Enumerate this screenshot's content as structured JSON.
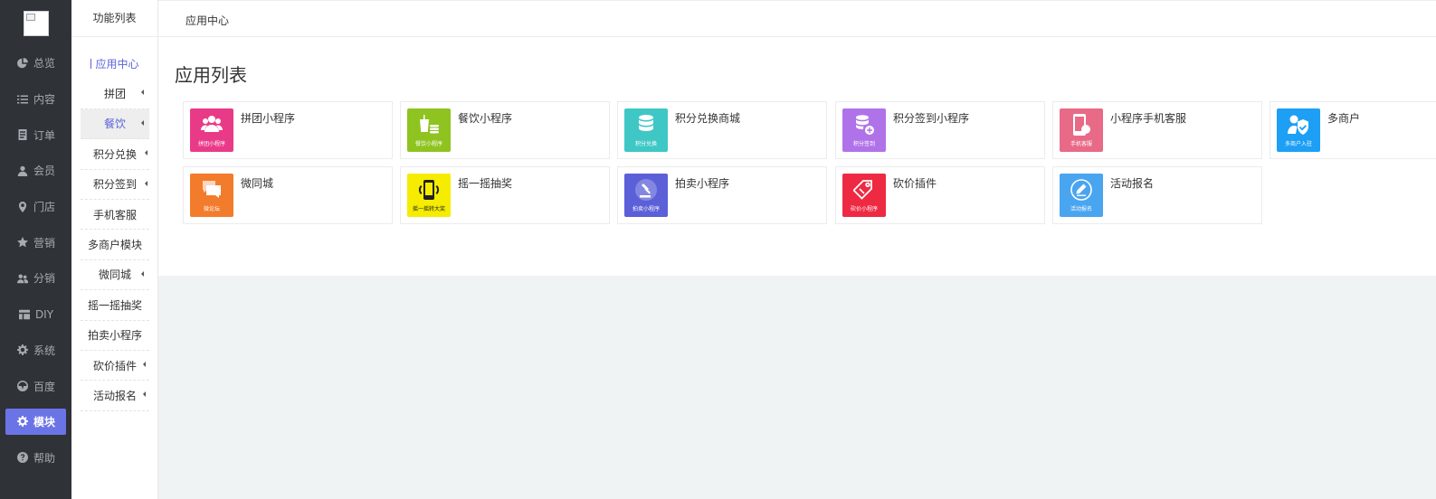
{
  "sidebar": {
    "items": [
      {
        "label": "总览",
        "icon": "pie-chart-icon"
      },
      {
        "label": "内容",
        "icon": "list-icon"
      },
      {
        "label": "订单",
        "icon": "document-icon"
      },
      {
        "label": "会员",
        "icon": "user-icon"
      },
      {
        "label": "门店",
        "icon": "location-pin-icon"
      },
      {
        "label": "营销",
        "icon": "star-icon"
      },
      {
        "label": "分销",
        "icon": "users-icon"
      },
      {
        "label": "DIY",
        "icon": "layout-icon"
      },
      {
        "label": "系统",
        "icon": "gear-icon"
      },
      {
        "label": "百度",
        "icon": "compass-icon"
      },
      {
        "label": "模块",
        "icon": "gear-icon",
        "active": true
      },
      {
        "label": "帮助",
        "icon": "question-icon"
      }
    ]
  },
  "subbar": {
    "title": "功能列表",
    "items": [
      {
        "label": "应用中心"
      },
      {
        "label": "拼团"
      },
      {
        "label": "餐饮"
      },
      {
        "label": "积分兑换"
      },
      {
        "label": "积分签到"
      },
      {
        "label": "手机客服"
      },
      {
        "label": "多商户模块"
      },
      {
        "label": "微同城"
      },
      {
        "label": "摇一摇抽奖"
      },
      {
        "label": "拍卖小程序"
      },
      {
        "label": "砍价插件"
      },
      {
        "label": "活动报名"
      }
    ]
  },
  "topbar": {
    "crumb": "应用中心"
  },
  "main": {
    "title": "应用列表",
    "apps": [
      {
        "name": "拼团小程序",
        "caption": "拼团小程序",
        "color": "#e93a88",
        "icon": "group-icon"
      },
      {
        "name": "餐饮小程序",
        "caption": "餐饮小程序",
        "color": "#8fc31f",
        "icon": "drink-icon"
      },
      {
        "name": "积分兑换商城",
        "caption": "积分兑换",
        "color": "#3fc7c5",
        "icon": "coins-icon"
      },
      {
        "name": "积分签到小程序",
        "caption": "积分签到",
        "color": "#b072e8",
        "icon": "coins-plus-icon"
      },
      {
        "name": "小程序手机客服",
        "caption": "手机客服",
        "color": "#e86a87",
        "icon": "phone-icon"
      },
      {
        "name": "多商户",
        "caption": "多商户入驻",
        "color": "#1c9ff5",
        "icon": "merchant-icon"
      },
      {
        "name": "微同城",
        "caption": "微论坛",
        "color": "#f37b2c",
        "icon": "chat-icon"
      },
      {
        "name": "摇一摇抽奖",
        "caption": "摇一摇转大奖",
        "color": "#f5ec00",
        "icon": "shake-phone-icon"
      },
      {
        "name": "拍卖小程序",
        "caption": "拍卖小程序",
        "color": "#5b5fd8",
        "icon": "gavel-icon"
      },
      {
        "name": "砍价插件",
        "caption": "砍价小程序",
        "color": "#ee2a43",
        "icon": "tag-icon"
      },
      {
        "name": "活动报名",
        "caption": "活动报名",
        "color": "#4aa5f0",
        "icon": "pen-icon"
      }
    ]
  }
}
